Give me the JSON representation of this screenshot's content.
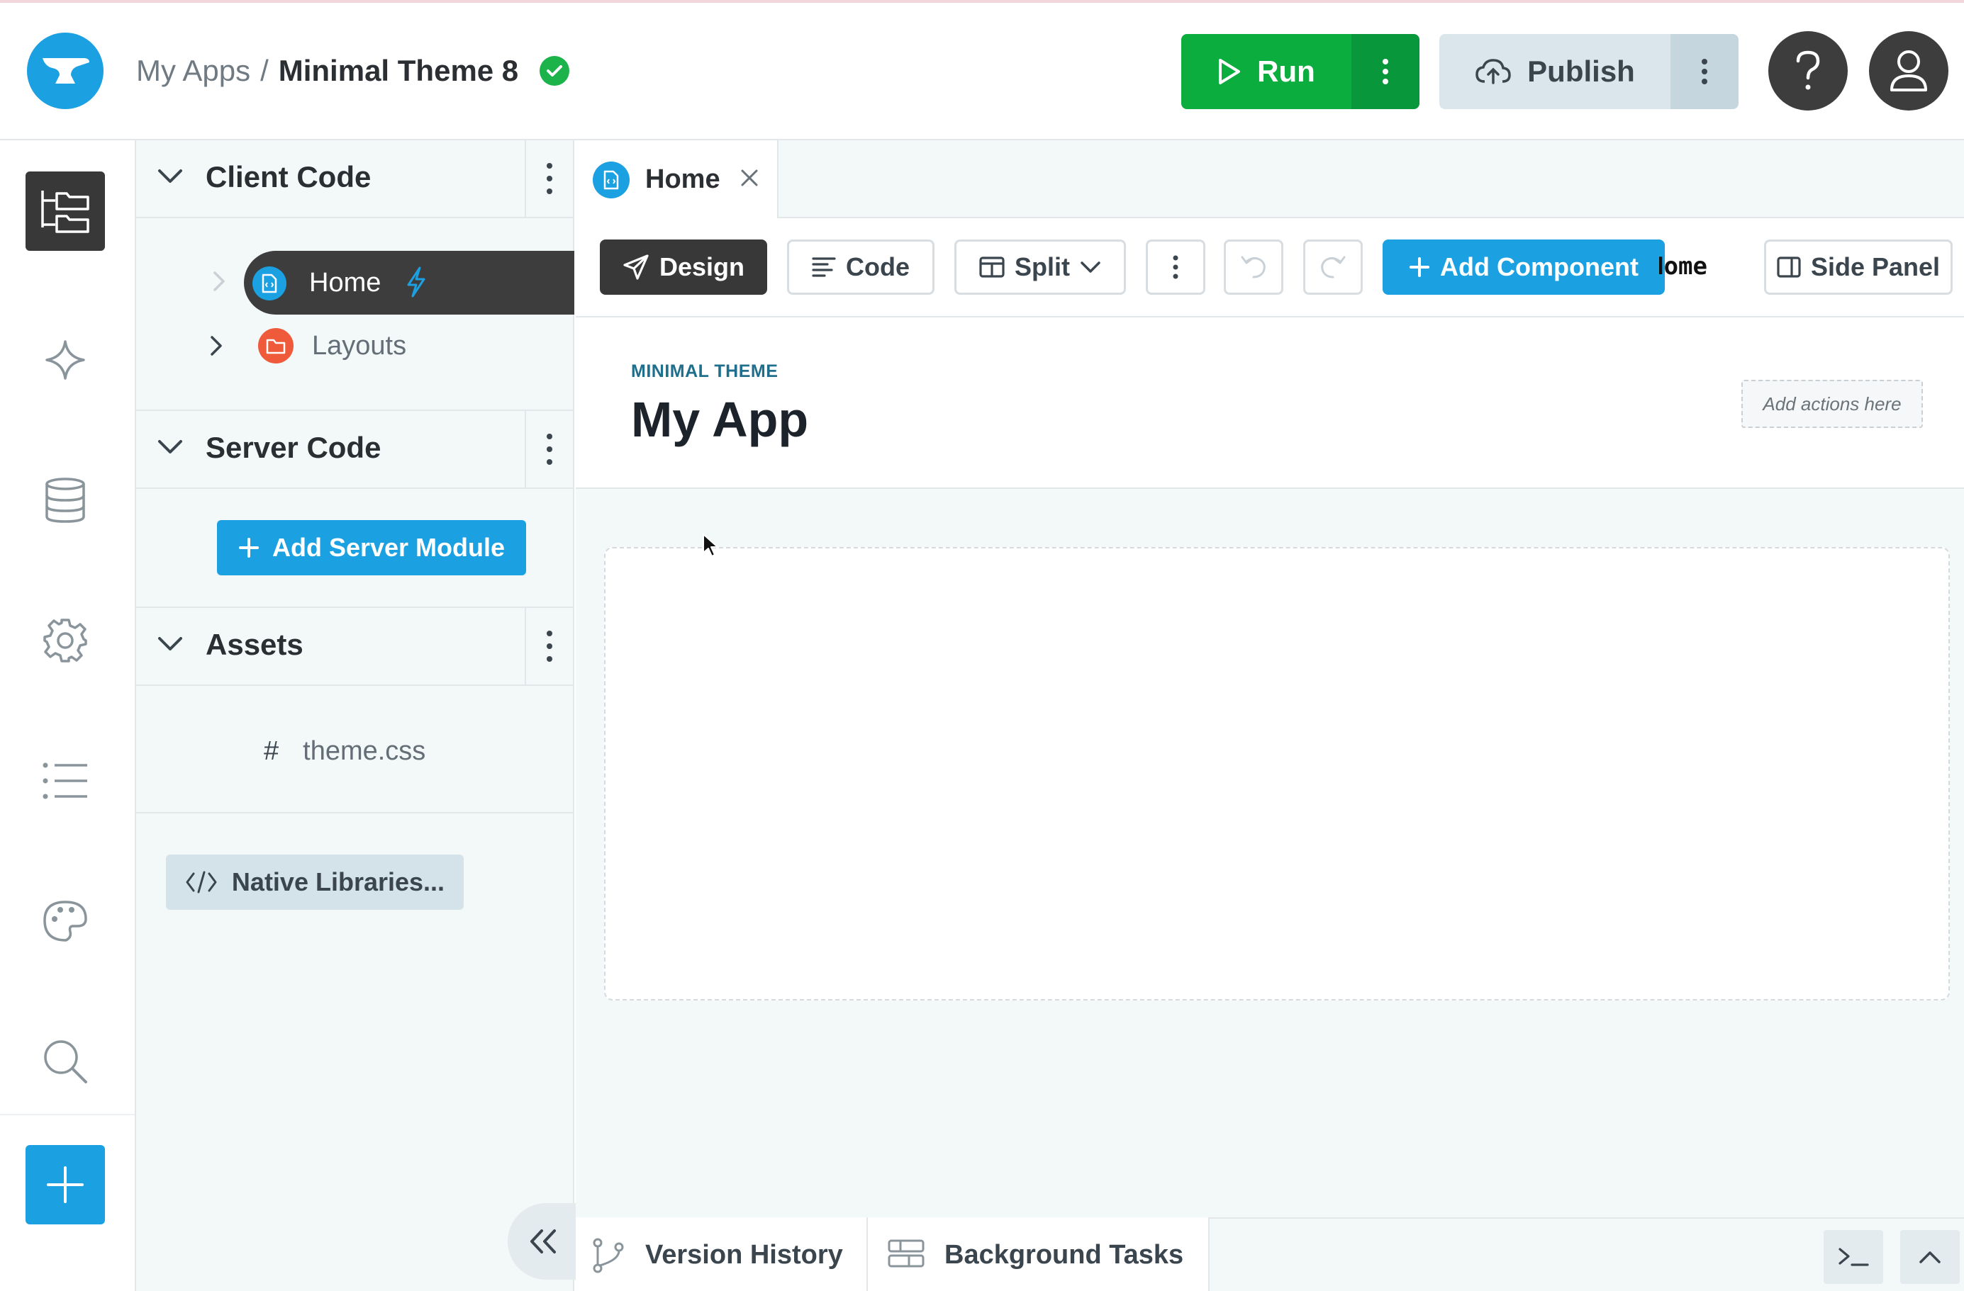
{
  "header": {
    "breadcrumb_root": "My Apps",
    "breadcrumb_sep": "/",
    "app_name": "Minimal Theme 8",
    "run_label": "Run",
    "publish_label": "Publish"
  },
  "explorer": {
    "client_code": {
      "title": "Client Code",
      "items": [
        {
          "label": "Home",
          "type": "form",
          "selected": true
        },
        {
          "label": "Layouts",
          "type": "folder"
        }
      ]
    },
    "server_code": {
      "title": "Server Code",
      "add_label": "Add Server Module"
    },
    "assets": {
      "title": "Assets",
      "items": [
        {
          "label": "theme.css",
          "prefix": "#"
        }
      ]
    },
    "native_libraries_label": "Native Libraries..."
  },
  "editor": {
    "tab_label": "Home",
    "toolbar": {
      "design_label": "Design",
      "code_label": "Code",
      "split_label": "Split",
      "add_component_label": "Add Component",
      "overflow_label": "Home",
      "side_panel_label": "Side Panel"
    },
    "canvas": {
      "theme_label": "MINIMAL THEME",
      "app_title": "My App",
      "actions_placeholder": "Add actions here"
    }
  },
  "bottom": {
    "version_history_label": "Version History",
    "background_tasks_label": "Background Tasks"
  },
  "colors": {
    "accent": "#1ba0e2",
    "run_green": "#0cad3f",
    "dark": "#383838",
    "folder_red": "#ee5a3a",
    "saved_green": "#1bb34a"
  }
}
